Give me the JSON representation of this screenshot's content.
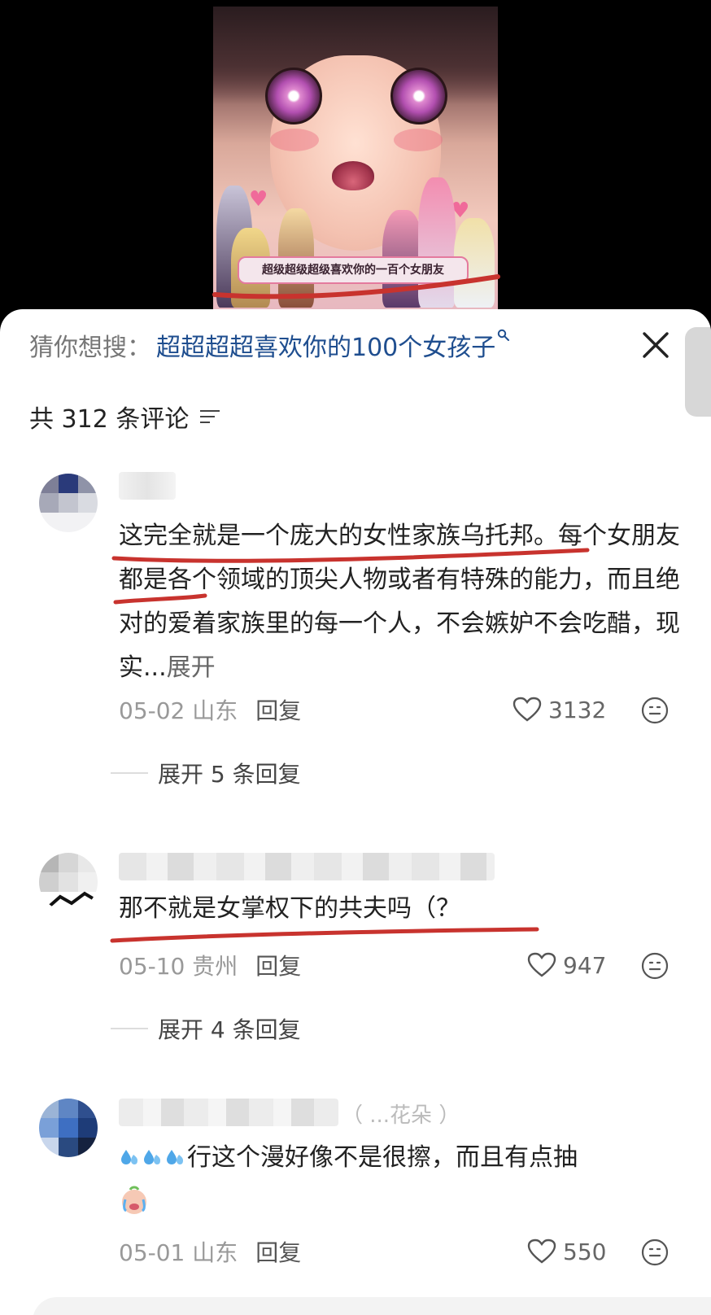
{
  "video": {
    "subtitle": "超级超级超级喜欢你的一百个女朋友"
  },
  "search_suggestion": {
    "prefix": "猜你想搜：",
    "query": "超超超超喜欢你的100个女孩子"
  },
  "comment_count": "共 312 条评论",
  "comments": [
    {
      "text": "这完全就是一个庞大的女性家族乌托邦。每个女朋友都是各个领域的顶尖人物或者有特殊的能力，而且绝对的爱着家族里的每一个人，不会嫉妒不会吃醋，现实...",
      "expand": "展开",
      "date": "05-02 山东",
      "reply": "回复",
      "likes": "3132",
      "replies": "展开 5 条回复"
    },
    {
      "text": "那不就是女掌权下的共夫吗（？",
      "date": "05-10 贵州",
      "reply": "回复",
      "likes": "947",
      "replies": "展开 4 条回复"
    },
    {
      "username_partial": "（ ...花朵 ）",
      "text": "行这个漫好像不是很擦，而且有点抽",
      "date": "05-01 山东",
      "reply": "回复",
      "likes": "550"
    }
  ],
  "colors": {
    "search_link": "#1f4e8f",
    "annotation_red": "#c8332e",
    "sheet_bg": "#ffffff"
  },
  "icons": [
    "close-icon",
    "sort-icon",
    "heart-icon",
    "emoji-icon",
    "search-icon",
    "sweat-drop-icon",
    "crying-face-icon"
  ]
}
